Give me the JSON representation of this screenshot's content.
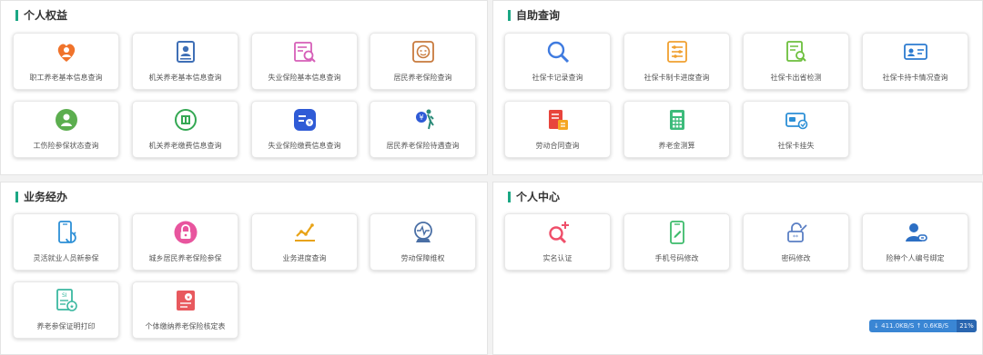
{
  "sections": {
    "personal_rights": {
      "title": "个人权益",
      "items": [
        {
          "label": "职工养老基本信息查询",
          "icon": "heart-person-icon"
        },
        {
          "label": "机关养老基本信息查询",
          "icon": "profile-card-icon"
        },
        {
          "label": "失业保险基本信息查询",
          "icon": "search-document-icon"
        },
        {
          "label": "居民养老保险查询",
          "icon": "elder-face-icon"
        },
        {
          "label": "工伤险参保状态查询",
          "icon": "worker-icon"
        },
        {
          "label": "机关养老缴费信息查询",
          "icon": "building-coin-icon"
        },
        {
          "label": "失业保险缴费信息查询",
          "icon": "payment-list-icon"
        },
        {
          "label": "居民养老保险待遇查询",
          "icon": "elder-walking-icon"
        }
      ]
    },
    "self_service": {
      "title": "自助查询",
      "items": [
        {
          "label": "社保卡记录查询",
          "icon": "magnifier-icon"
        },
        {
          "label": "社保卡制卡进度查询",
          "icon": "sliders-icon"
        },
        {
          "label": "社保卡出省检测",
          "icon": "checklist-search-icon"
        },
        {
          "label": "社保卡持卡情况查询",
          "icon": "id-card-icon"
        },
        {
          "label": "劳动合同查询",
          "icon": "contract-icon"
        },
        {
          "label": "养老金测算",
          "icon": "calculator-icon"
        },
        {
          "label": "社保卡挂失",
          "icon": "card-report-icon"
        }
      ]
    },
    "business": {
      "title": "业务经办",
      "items": [
        {
          "label": "灵活就业人员新参保",
          "icon": "phone-refresh-icon"
        },
        {
          "label": "城乡居民养老保险参保",
          "icon": "lock-circle-icon"
        },
        {
          "label": "业务进度查询",
          "icon": "progress-chart-icon"
        },
        {
          "label": "劳动保障维权",
          "icon": "scale-shield-icon"
        },
        {
          "label": "养老参保证明打印",
          "icon": "certificate-icon"
        },
        {
          "label": "个体缴纳养老保险核定表",
          "icon": "stamp-form-icon"
        }
      ]
    },
    "personal_center": {
      "title": "个人中心",
      "items": [
        {
          "label": "实名认证",
          "icon": "search-plus-icon"
        },
        {
          "label": "手机号码修改",
          "icon": "phone-edit-icon"
        },
        {
          "label": "密码修改",
          "icon": "password-edit-icon"
        },
        {
          "label": "险种个人编号绑定",
          "icon": "user-link-icon"
        }
      ]
    }
  },
  "net_widget": {
    "down": "411.0KB/S",
    "up": "0.6KB/S",
    "percent": "21%"
  },
  "colors": {
    "accent": "#1ba784",
    "panel_bg": "#ffffff",
    "page_bg": "#f2f2f2"
  }
}
